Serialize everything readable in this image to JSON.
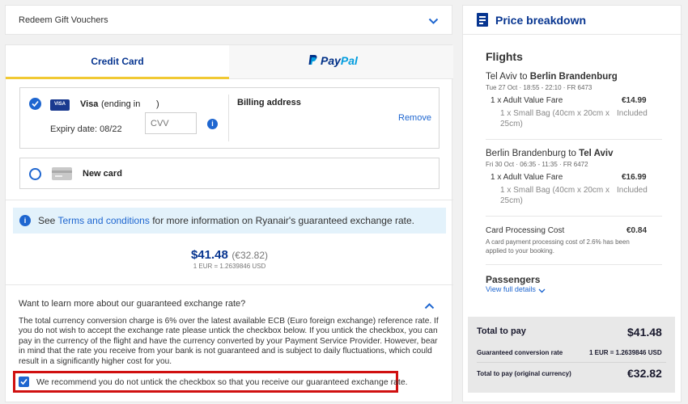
{
  "voucher": {
    "label": "Redeem Gift Vouchers"
  },
  "tabs": {
    "credit_card": "Credit Card",
    "paypal_p1": "Pay",
    "paypal_p2": "Pal"
  },
  "saved_card": {
    "brand_badge": "VISA",
    "brand": "Visa",
    "ending_label": "(ending in",
    "ending_close": ")",
    "expiry": "Expiry date: 08/22",
    "cvv_placeholder": "CVV",
    "billing_label": "Billing address",
    "remove_label": "Remove"
  },
  "new_card": {
    "label": "New card"
  },
  "info_banner": {
    "prefix": "See ",
    "link": "Terms and conditions",
    "suffix": " for more information on Ryanair's guaranteed exchange rate."
  },
  "price": {
    "usd": "$41.48",
    "eur": "(€32.82)",
    "rate": "1 EUR = 1.2639846 USD"
  },
  "exchange": {
    "question": "Want to learn more about our guaranteed exchange rate?",
    "paragraph": "The total currency conversion charge is 6% over the latest available ECB (Euro foreign exchange) reference rate. If you do not wish to accept the exchange rate please untick the checkbox below. If you untick the checkbox, you can pay in the currency of the flight and have the currency converted by your Payment Service Provider. However, bear in mind that the rate you receive from your bank is not guaranteed and is subject to daily fluctuations, which could result in a significantly higher cost for you.",
    "checkbox_label": "We recommend you do not untick the checkbox so that you receive our guaranteed exchange rate."
  },
  "breakdown": {
    "title": "Price breakdown",
    "flights_heading": "Flights",
    "outbound": {
      "from": "Tel Aviv",
      "to_word": " to ",
      "to": "Berlin Brandenburg",
      "details": "Tue 27 Oct  ·  18:55 - 22:10  ·  FR 6473",
      "fare_label": "1 x Adult Value Fare",
      "fare_price": "€14.99",
      "bag_line1": "1 x Small Bag (40cm x 20cm x",
      "bag_line2": "25cm)",
      "bag_price": "Included"
    },
    "inbound": {
      "from": "Berlin Brandenburg",
      "to_word": " to ",
      "to": "Tel Aviv",
      "details": "Fri 30 Oct  ·  06:35 - 11:35  ·  FR 6472",
      "fare_label": "1 x Adult Value Fare",
      "fare_price": "€16.99",
      "bag_line1": "1 x Small Bag (40cm x 20cm x",
      "bag_line2": "25cm)",
      "bag_price": "Included"
    },
    "processing": {
      "label": "Card Processing Cost",
      "price": "€0.84",
      "note_line1": "A card payment processing cost of 2.6% has been",
      "note_line2": "applied to your booking."
    },
    "passengers": {
      "heading": "Passengers",
      "link": "View full details"
    },
    "totals": {
      "total_label": "Total to pay",
      "total_value": "$41.48",
      "conversion_label": "Guaranteed conversion rate",
      "conversion_value": "1 EUR = 1.2639846 USD",
      "original_label": "Total to pay (original currency)",
      "original_value": "€32.82"
    }
  },
  "colors": {
    "accent": "#1e66d0",
    "brand": "#073590",
    "highlight": "#d01010",
    "tab_underline": "#f1c933"
  }
}
